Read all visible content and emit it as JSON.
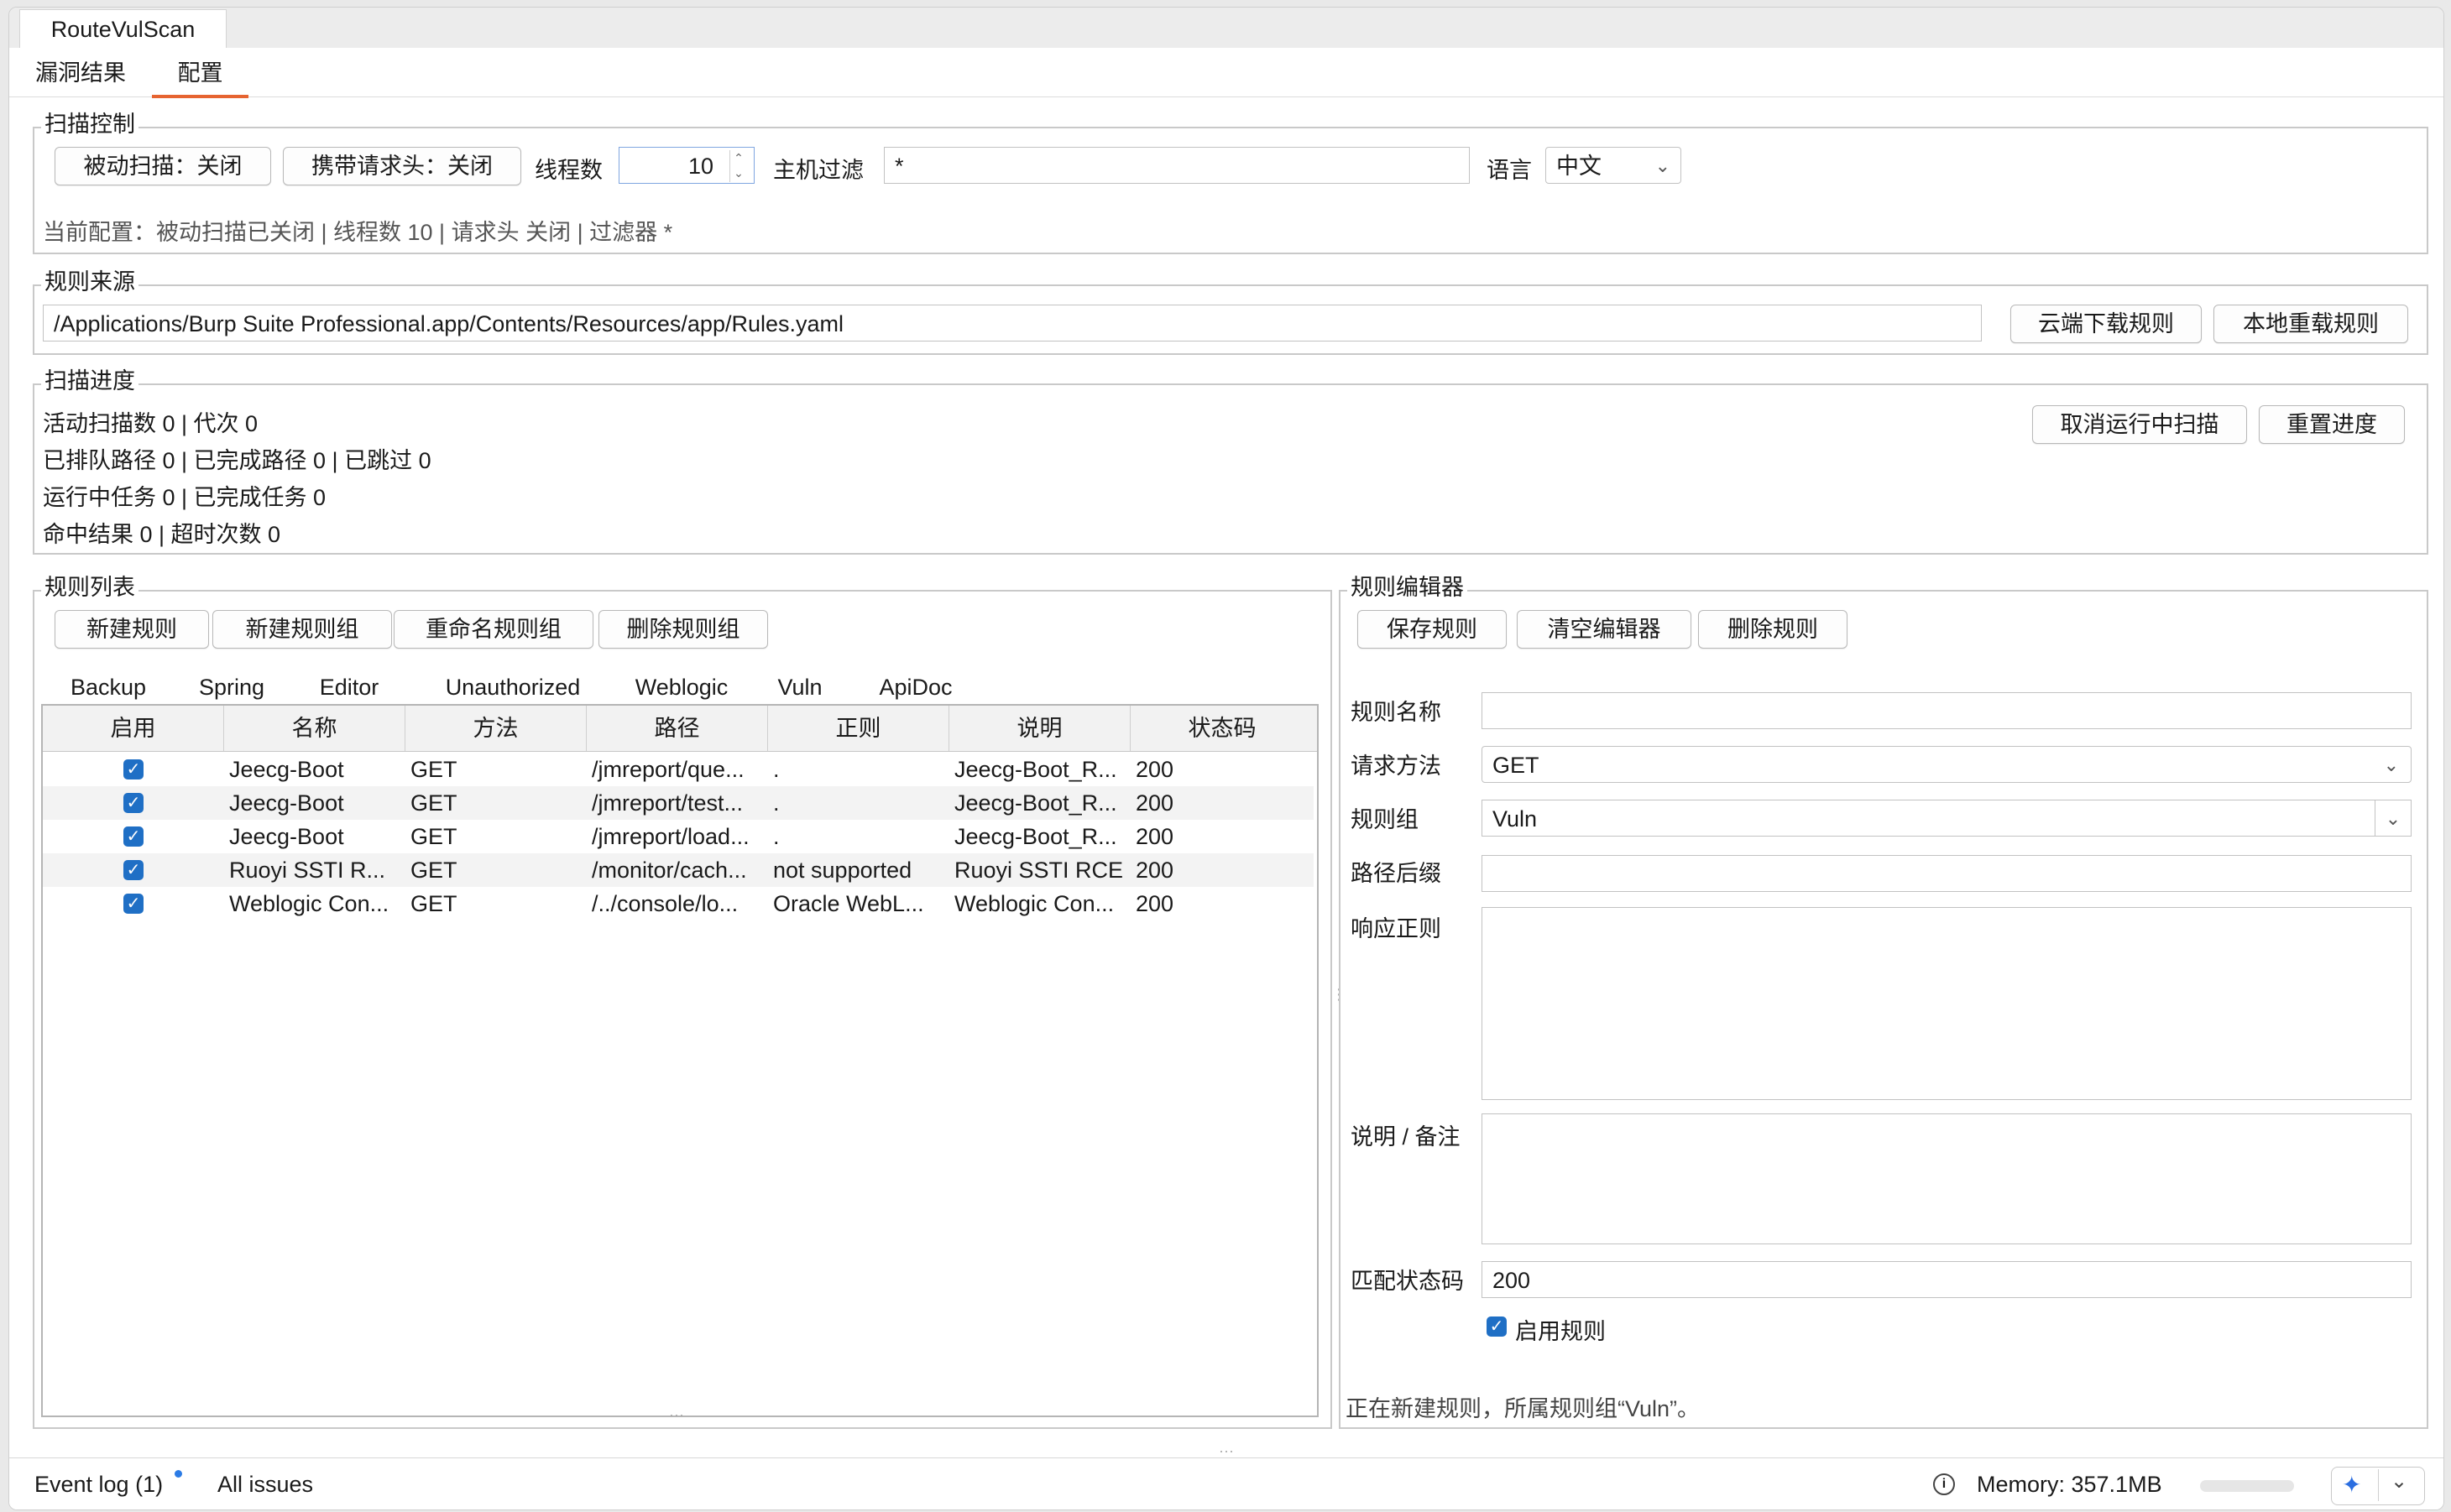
{
  "app_tab": "RouteVulScan",
  "subtabs": [
    "漏洞结果",
    "配置"
  ],
  "scan_control": {
    "title": "扫描控制",
    "passive_btn": "被动扫描：关闭",
    "header_btn": "携带请求头：关闭",
    "threads_label": "线程数",
    "threads_value": "10",
    "host_filter_label": "主机过滤",
    "host_filter_value": "*",
    "language_label": "语言",
    "language_value": "中文",
    "current_config": "当前配置：被动扫描已关闭 | 线程数 10 | 请求头 关闭 | 过滤器 *"
  },
  "rule_source": {
    "title": "规则来源",
    "path": "/Applications/Burp Suite Professional.app/Contents/Resources/app/Rules.yaml",
    "cloud_btn": "云端下载规则",
    "local_btn": "本地重载规则"
  },
  "scan_progress": {
    "title": "扫描进度",
    "lines": [
      "活动扫描数 0 | 代次 0",
      "已排队路径 0 | 已完成路径 0 | 已跳过 0",
      "运行中任务 0 | 已完成任务 0",
      "命中结果 0 | 超时次数 0"
    ],
    "cancel_btn": "取消运行中扫描",
    "reset_btn": "重置进度"
  },
  "rule_list": {
    "title": "规则列表",
    "buttons": [
      "新建规则",
      "新建规则组",
      "重命名规则组",
      "删除规则组"
    ],
    "tabs": [
      "Backup",
      "Spring",
      "Editor",
      "Unauthorized",
      "Weblogic",
      "Vuln",
      "ApiDoc"
    ],
    "active_tab": "Vuln",
    "columns": [
      "启用",
      "名称",
      "方法",
      "路径",
      "正则",
      "说明",
      "状态码"
    ],
    "rows": [
      {
        "enabled": true,
        "name": "Jeecg-Boot",
        "method": "GET",
        "path": "/jmreport/que...",
        "regex": ".",
        "desc": "Jeecg-Boot_R...",
        "status": "200"
      },
      {
        "enabled": true,
        "name": "Jeecg-Boot",
        "method": "GET",
        "path": "/jmreport/test...",
        "regex": ".",
        "desc": "Jeecg-Boot_R...",
        "status": "200"
      },
      {
        "enabled": true,
        "name": "Jeecg-Boot",
        "method": "GET",
        "path": "/jmreport/load...",
        "regex": ".",
        "desc": "Jeecg-Boot_R...",
        "status": "200"
      },
      {
        "enabled": true,
        "name": "Ruoyi SSTI R...",
        "method": "GET",
        "path": "/monitor/cach...",
        "regex": "not supported",
        "desc": "Ruoyi SSTI RCE",
        "status": "200"
      },
      {
        "enabled": true,
        "name": "Weblogic Con...",
        "method": "GET",
        "path": "/../console/lo...",
        "regex": "Oracle WebL...",
        "desc": "Weblogic Con...",
        "status": "200"
      }
    ]
  },
  "rule_editor": {
    "title": "规则编辑器",
    "buttons": [
      "保存规则",
      "清空编辑器",
      "删除规则"
    ],
    "name_label": "规则名称",
    "name_value": "",
    "method_label": "请求方法",
    "method_value": "GET",
    "group_label": "规则组",
    "group_value": "Vuln",
    "path_label": "路径后缀",
    "path_value": "",
    "regex_label": "响应正则",
    "note_label": "说明 / 备注",
    "status_label": "匹配状态码",
    "status_value": "200",
    "enable_label": "启用规则",
    "enable_checked": true,
    "footer": "正在新建规则，所属规则组“Vuln”。"
  },
  "status_bar": {
    "event_log": "Event log (1)",
    "all_issues": "All issues",
    "memory": "Memory: 357.1MB"
  },
  "colors": {
    "accent": "#e66431",
    "check": "#1f6fc5",
    "dot": "#2b7be5"
  }
}
